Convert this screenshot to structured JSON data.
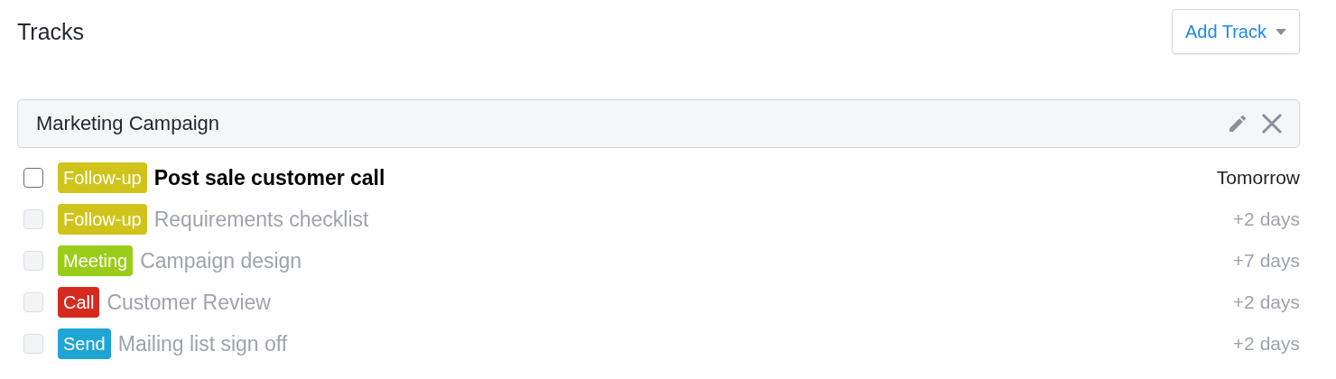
{
  "title": "Tracks",
  "add_button": {
    "label": "Add Track"
  },
  "group": {
    "name": "Marketing Campaign"
  },
  "tasks": [
    {
      "tag": "Follow-up",
      "color": "#d0c41c",
      "title": "Post sale customer call",
      "due": "Tomorrow",
      "checked": false,
      "disabled": false
    },
    {
      "tag": "Follow-up",
      "color": "#d0c41c",
      "title": "Requirements checklist",
      "due": "+2 days",
      "checked": false,
      "disabled": true
    },
    {
      "tag": "Meeting",
      "color": "#9acd1a",
      "title": "Campaign design",
      "due": "+7 days",
      "checked": false,
      "disabled": true
    },
    {
      "tag": "Call",
      "color": "#d42b1e",
      "title": "Customer Review",
      "due": "+2 days",
      "checked": false,
      "disabled": true
    },
    {
      "tag": "Send",
      "color": "#1ea5d4",
      "title": "Mailing list sign off",
      "due": "+2 days",
      "checked": false,
      "disabled": true
    }
  ]
}
